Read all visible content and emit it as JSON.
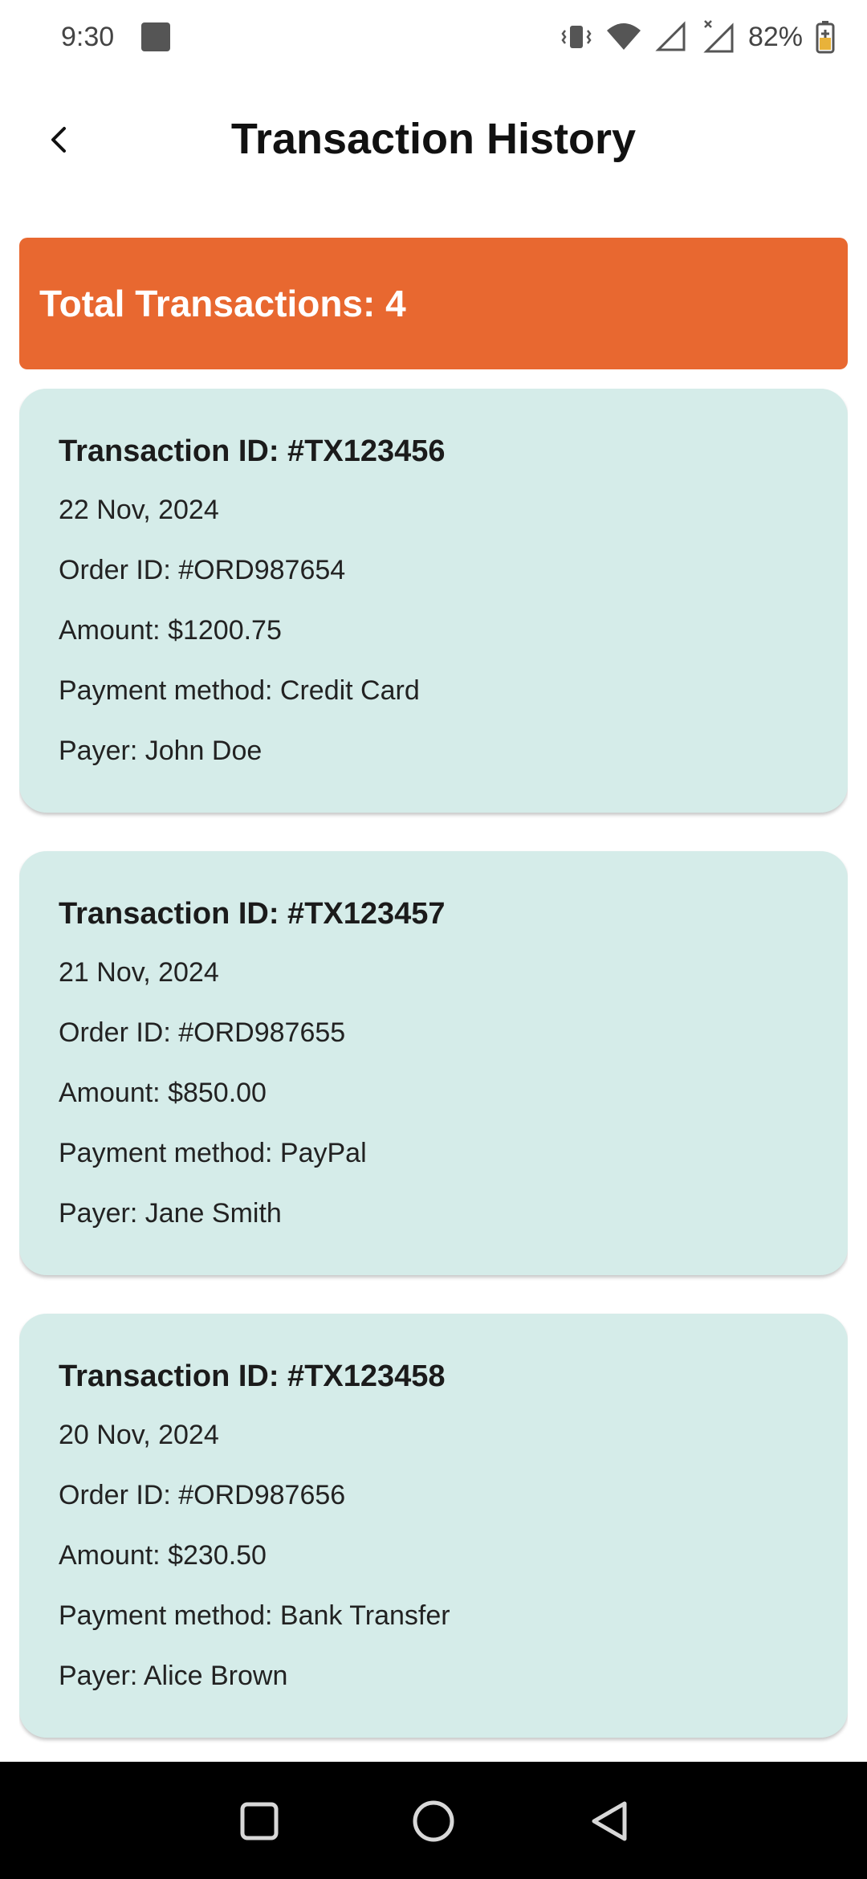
{
  "status_bar": {
    "time": "9:30",
    "battery": "82%",
    "icons": [
      "notification-square-icon",
      "vibrate-icon",
      "wifi-icon",
      "signal-icon",
      "signal-no-data-icon",
      "battery-charging-icon"
    ]
  },
  "app_bar": {
    "title": "Transaction History",
    "back_icon": "chevron-left-icon"
  },
  "summary": {
    "text": "Total Transactions: 4",
    "color": "#e86830"
  },
  "transactions": [
    {
      "id": "Transaction ID: #TX123456",
      "date": "22 Nov, 2024",
      "order": "Order ID: #ORD987654",
      "amount": "Amount: $1200.75",
      "method": "Payment method: Credit Card",
      "payer": "Payer: John Doe"
    },
    {
      "id": "Transaction ID: #TX123457",
      "date": "21 Nov, 2024",
      "order": "Order ID: #ORD987655",
      "amount": "Amount: $850.00",
      "method": "Payment method: PayPal",
      "payer": "Payer: Jane Smith"
    },
    {
      "id": "Transaction ID: #TX123458",
      "date": "20 Nov, 2024",
      "order": "Order ID: #ORD987656",
      "amount": "Amount: $230.50",
      "method": "Payment method: Bank Transfer",
      "payer": "Payer: Alice Brown"
    }
  ],
  "card_color": "#d5ece9",
  "nav_bar": {
    "icons": [
      "recents-square-icon",
      "home-circle-icon",
      "back-triangle-icon"
    ]
  }
}
